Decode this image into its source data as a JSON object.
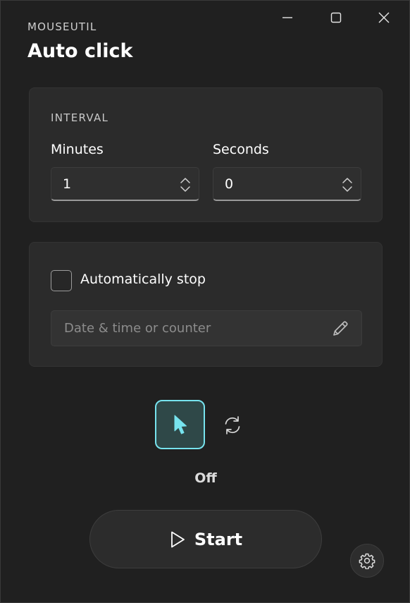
{
  "window": {
    "app_name": "MOUSEUTIL",
    "title": "Auto click",
    "caption_buttons": [
      "minimize-icon",
      "maximize-icon",
      "close-icon"
    ]
  },
  "interval": {
    "section_label": "INTERVAL",
    "minutes_label": "Minutes",
    "minutes_value": "1",
    "seconds_label": "Seconds",
    "seconds_value": "0"
  },
  "auto_stop": {
    "checkbox_label": "Automatically stop",
    "checked": false,
    "input_placeholder": "Date & time or counter",
    "input_value": "",
    "edit_icon": "pencil-icon"
  },
  "mode": {
    "selected": "mouse-pointer",
    "options": [
      "mouse-pointer-icon",
      "refresh-icon"
    ],
    "accent_color": "#77e3ee"
  },
  "status": {
    "text": "Off"
  },
  "actions": {
    "start_label": "Start",
    "start_icon": "play-icon",
    "settings_icon": "gear-icon"
  }
}
